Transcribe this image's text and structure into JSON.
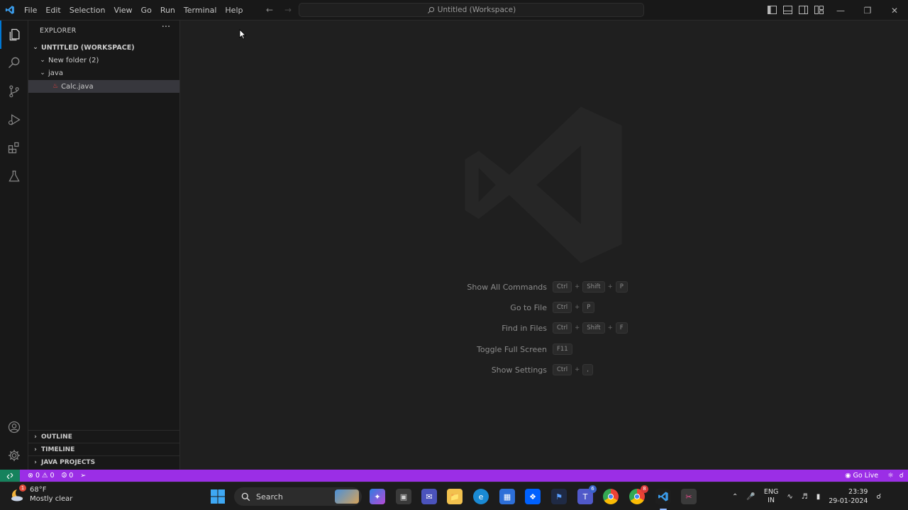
{
  "titlebar": {
    "menu": [
      "File",
      "Edit",
      "Selection",
      "View",
      "Go",
      "Run",
      "Terminal",
      "Help"
    ],
    "command_center": "Untitled (Workspace)"
  },
  "sidebar": {
    "header": "EXPLORER",
    "workspace": "UNTITLED (WORKSPACE)",
    "tree": [
      {
        "label": "New folder (2)",
        "type": "folder"
      },
      {
        "label": "java",
        "type": "folder"
      },
      {
        "label": "Calc.java",
        "type": "file"
      }
    ],
    "panes": [
      "OUTLINE",
      "TIMELINE",
      "JAVA PROJECTS"
    ]
  },
  "editor": {
    "shortcuts": [
      {
        "label": "Show All Commands",
        "keys": [
          "Ctrl",
          "Shift",
          "P"
        ]
      },
      {
        "label": "Go to File",
        "keys": [
          "Ctrl",
          "P"
        ]
      },
      {
        "label": "Find in Files",
        "keys": [
          "Ctrl",
          "Shift",
          "F"
        ]
      },
      {
        "label": "Toggle Full Screen",
        "keys": [
          "F11"
        ]
      },
      {
        "label": "Show Settings",
        "keys": [
          "Ctrl",
          ","
        ]
      }
    ]
  },
  "statusbar": {
    "errors": "0",
    "warnings": "0",
    "ports": "0",
    "go_live": "Go Live"
  },
  "taskbar": {
    "temperature": "68°F",
    "condition": "Mostly clear",
    "search_label": "Search",
    "lang_line1": "ENG",
    "lang_line2": "IN",
    "time": "23:39",
    "date": "29-01-2024",
    "teams_badge": "6",
    "chrome_badge": "8",
    "weather_badge": "1"
  },
  "colors": {
    "statusbar": "#9b2ee6",
    "remote": "#16825d",
    "accent": "#0078d4"
  }
}
